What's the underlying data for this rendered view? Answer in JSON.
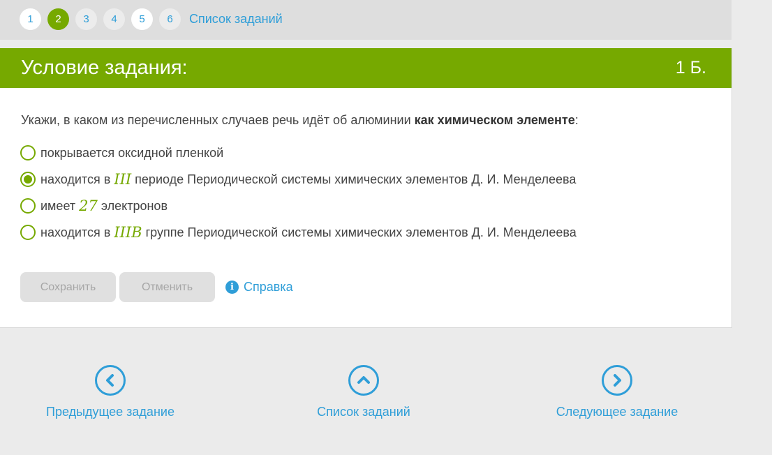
{
  "pager": {
    "pages": [
      {
        "label": "1",
        "state": "white"
      },
      {
        "label": "2",
        "state": "active"
      },
      {
        "label": "3",
        "state": "grey"
      },
      {
        "label": "4",
        "state": "grey"
      },
      {
        "label": "5",
        "state": "white"
      },
      {
        "label": "6",
        "state": "grey"
      }
    ],
    "task_list_label": "Список заданий"
  },
  "card": {
    "title": "Условие задания:",
    "points": "1 Б."
  },
  "question": {
    "text_before": "Укажи, в каком из перечисленных случаев речь идёт об алюминии ",
    "text_bold": "как химическом элементе",
    "text_after": ":"
  },
  "options": [
    {
      "before": "покрывается оксидной пленкой",
      "math": "",
      "after": "",
      "checked": false
    },
    {
      "before": "находится в",
      "math": "III",
      "after": "периоде Периодической системы химических элементов Д. И. Менделеева",
      "checked": true
    },
    {
      "before": "имеет",
      "math": "27",
      "after": "электронов",
      "checked": false
    },
    {
      "before": "находится в",
      "math": "IIIB",
      "after": "группе Периодической системы химических элементов Д. И. Менделеева",
      "checked": false
    }
  ],
  "actions": {
    "save_label": "Сохранить",
    "cancel_label": "Отменить",
    "help_label": "Справка",
    "help_icon": "info-icon"
  },
  "nav": {
    "prev_label": "Предыдущее задание",
    "list_label": "Список заданий",
    "next_label": "Следующее задание"
  },
  "colors": {
    "accent_green": "#76a900",
    "link_blue": "#2f9ed8"
  }
}
